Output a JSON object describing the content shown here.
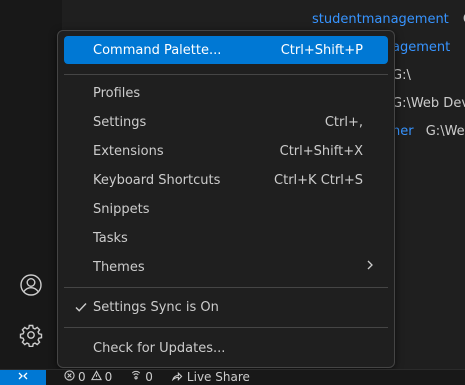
{
  "recent": {
    "line1_name": "studentmanagement",
    "line1_path": "G",
    "line2": "agement",
    "line3": "G:\\",
    "line4": "G:\\Web Dev",
    "line5_name": "ner",
    "line5_path": "G:\\We"
  },
  "menu": {
    "command_palette": {
      "label": "Command Palette...",
      "shortcut": "Ctrl+Shift+P"
    },
    "profiles": {
      "label": "Profiles"
    },
    "settings": {
      "label": "Settings",
      "shortcut": "Ctrl+,"
    },
    "extensions": {
      "label": "Extensions",
      "shortcut": "Ctrl+Shift+X"
    },
    "keyboard_shortcuts": {
      "label": "Keyboard Shortcuts",
      "shortcut": "Ctrl+K Ctrl+S"
    },
    "snippets": {
      "label": "Snippets"
    },
    "tasks": {
      "label": "Tasks"
    },
    "themes": {
      "label": "Themes"
    },
    "settings_sync": {
      "label": "Settings Sync is On"
    },
    "check_updates": {
      "label": "Check for Updates..."
    }
  },
  "status_bar": {
    "errors": "0",
    "warnings": "0",
    "ports": "0",
    "live_share": "Live Share"
  },
  "colors": {
    "accent": "#0078d4",
    "link": "#3794ff",
    "background": "#1f1f1f"
  },
  "icons": [
    "accounts-icon",
    "manage-gear-icon",
    "remote-icon",
    "error-icon",
    "warning-icon",
    "ports-icon",
    "live-share-icon",
    "check-icon",
    "chevron-right-icon"
  ]
}
